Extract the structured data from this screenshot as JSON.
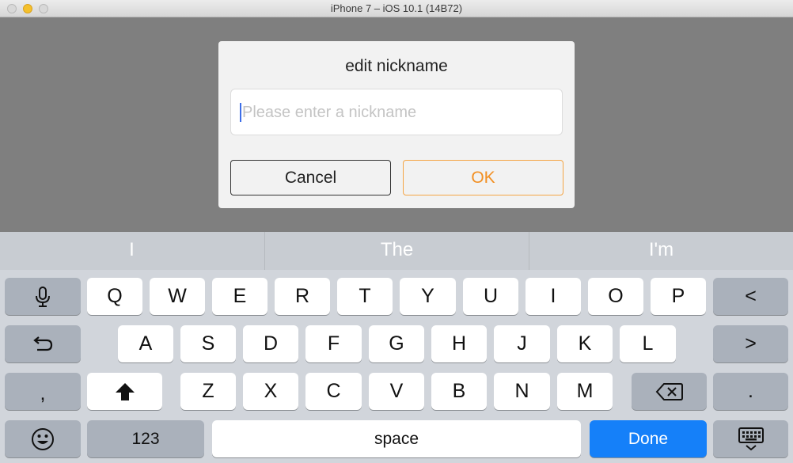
{
  "window": {
    "title": "iPhone 7 – iOS 10.1 (14B72)"
  },
  "dialog": {
    "title": "edit nickname",
    "input_value": "",
    "input_placeholder": "Please enter a nickname",
    "cancel_label": "Cancel",
    "ok_label": "OK"
  },
  "keyboard": {
    "suggestions": [
      "I",
      "The",
      "I'm"
    ],
    "row1": [
      "Q",
      "W",
      "E",
      "R",
      "T",
      "Y",
      "U",
      "I",
      "O",
      "P"
    ],
    "row2": [
      "A",
      "S",
      "D",
      "F",
      "G",
      "H",
      "J",
      "K",
      "L"
    ],
    "row3": [
      "Z",
      "X",
      "C",
      "V",
      "B",
      "N",
      "M"
    ],
    "comma_key": ",",
    "period_key": ".",
    "numbers_key": "123",
    "space_key": "space",
    "done_key": "Done",
    "left_arrow_key": "<",
    "right_arrow_key": ">"
  },
  "colors": {
    "ok_accent": "#f29024",
    "done_blue": "#1580f9",
    "caret": "#3d6ee8"
  },
  "icons": [
    "microphone-icon",
    "undo-icon",
    "shift-icon",
    "backspace-icon",
    "emoji-icon",
    "keyboard-dismiss-icon"
  ]
}
